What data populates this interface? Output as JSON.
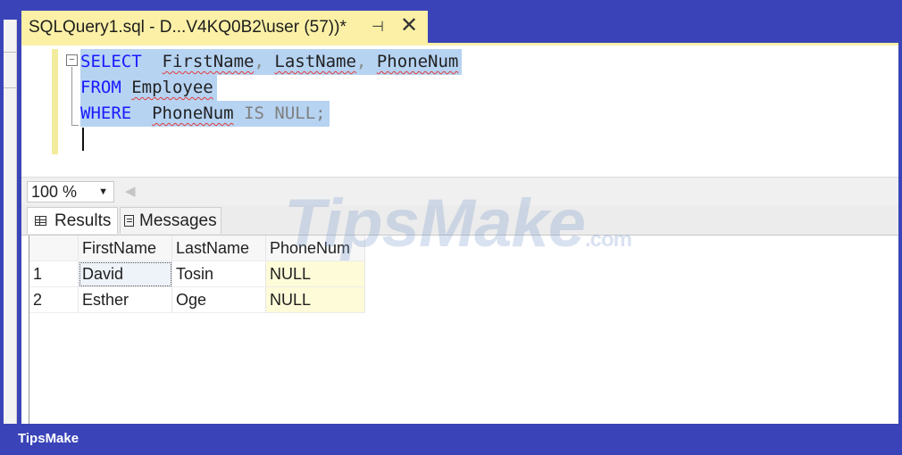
{
  "document_tab": {
    "title": "SQLQuery1.sql - D...V4KQ0B2\\user (57))*",
    "pin_glyph": "⊣",
    "close_glyph": "✕"
  },
  "editor": {
    "collapse_glyph": "−",
    "lines": [
      {
        "kw": "SELECT",
        "parts": [
          "FirstName",
          ",",
          "LastName",
          ",",
          "PhoneNum"
        ]
      },
      {
        "kw": "FROM",
        "parts": [
          "Employee"
        ]
      },
      {
        "kw": "WHERE",
        "parts": [
          "PhoneNum",
          "IS NULL;"
        ]
      }
    ]
  },
  "zoom": {
    "value": "100 %"
  },
  "results_tabs": {
    "results": "Results",
    "messages": "Messages"
  },
  "grid": {
    "columns": [
      "FirstName",
      "LastName",
      "PhoneNum"
    ],
    "rows": [
      {
        "num": "1",
        "first": "David",
        "last": "Tosin",
        "phone": "NULL"
      },
      {
        "num": "2",
        "first": "Esther",
        "last": "Oge",
        "phone": "NULL"
      }
    ]
  },
  "watermark": {
    "main": "TipsMake",
    "suffix": ".com"
  },
  "footer": {
    "brand": "TipsMake"
  },
  "colors": {
    "frame": "#3a44b8",
    "tab_active": "#fbf0a6",
    "selection": "#b6d3f2",
    "keyword": "#1a1aff"
  }
}
